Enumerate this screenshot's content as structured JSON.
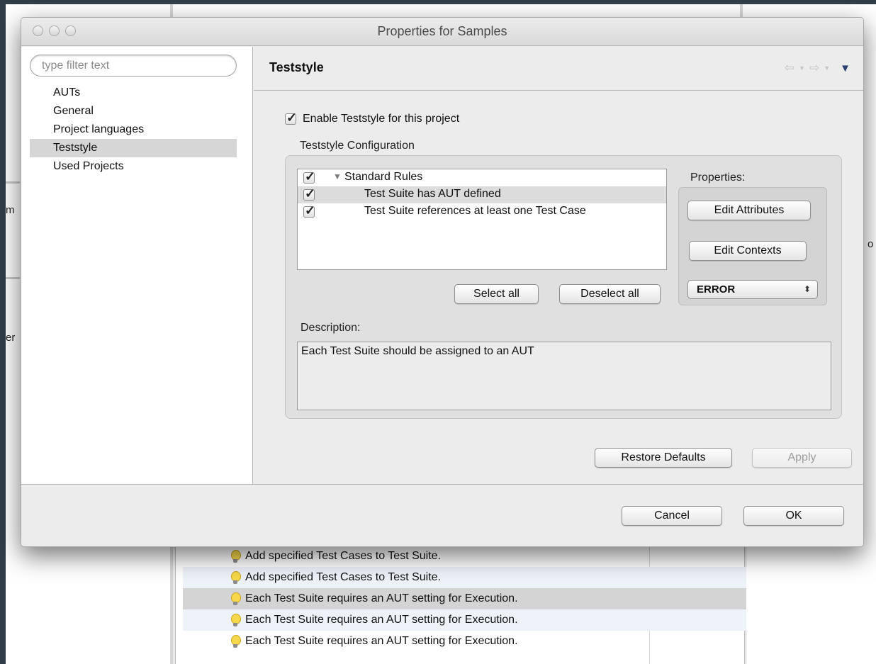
{
  "dialog": {
    "title": "Properties for Samples"
  },
  "sidebar": {
    "filter_placeholder": "type filter text",
    "items": [
      {
        "label": "AUTs"
      },
      {
        "label": "General"
      },
      {
        "label": "Project languages"
      },
      {
        "label": "Teststyle"
      },
      {
        "label": "Used Projects"
      }
    ],
    "selected": "Teststyle"
  },
  "page": {
    "title": "Teststyle",
    "enable_label": "Enable Teststyle for this project",
    "enable_checked": true,
    "config_title": "Teststyle Configuration",
    "rules": {
      "group_label": "Standard Rules",
      "items": [
        {
          "label": "Test Suite has AUT defined",
          "checked": true,
          "selected": true
        },
        {
          "label": "Test Suite references at least one Test Case",
          "checked": true,
          "selected": false
        }
      ]
    },
    "select_all": "Select all",
    "deselect_all": "Deselect all",
    "properties_label": "Properties:",
    "edit_attributes": "Edit Attributes",
    "edit_contexts": "Edit Contexts",
    "severity": "ERROR",
    "description_label": "Description:",
    "description_text": "Each Test Suite should be assigned to an AUT",
    "restore_defaults": "Restore Defaults",
    "apply": "Apply"
  },
  "footer": {
    "cancel": "Cancel",
    "ok": "OK"
  },
  "background": {
    "rows": [
      {
        "text": "Add specified Test Cases to Test Suite."
      },
      {
        "text": "Add specified Test Cases to Test Suite."
      },
      {
        "text": "Each Test Suite requires an AUT setting for Execution."
      },
      {
        "text": "Each Test Suite requires an AUT setting for Execution."
      },
      {
        "text": "Each Test Suite requires an AUT setting for Execution."
      }
    ],
    "stub_left_1": "m",
    "stub_left_2": "er",
    "stub_right": "o"
  },
  "colors": {
    "desktop": "#2f3e48",
    "dialog_bg": "#ececec",
    "selection": "#d6d6d6",
    "nav_menu_accent": "#2a3f6e"
  }
}
